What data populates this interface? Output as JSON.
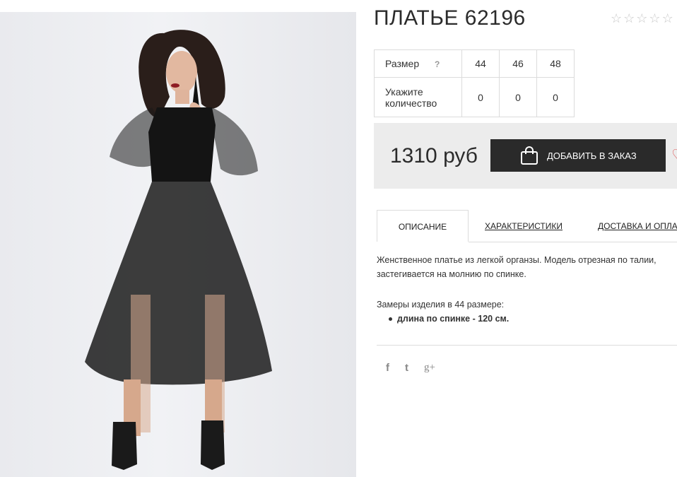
{
  "product": {
    "title": "ПЛАТЬЕ 62196",
    "rating_stars": [
      "☆",
      "☆",
      "☆",
      "☆",
      "☆"
    ]
  },
  "sizes": {
    "size_label": "Размер",
    "help_icon": "?",
    "values": [
      "44",
      "46",
      "48"
    ],
    "qty_label": "Укажите количество",
    "quantities": [
      "0",
      "0",
      "0"
    ]
  },
  "buy": {
    "price": "1310 руб",
    "add_button": "ДОБАВИТЬ В ЗАКАЗ",
    "heart_icon": "♡"
  },
  "tabs": {
    "description": "ОПИСАНИЕ",
    "characteristics": "ХАРАКТЕРИСТИКИ",
    "delivery": "ДОСТАВКА И ОПЛАТА"
  },
  "description": {
    "text": "Женственное платье из легкой органзы. Модель отрезная по талии, застегивается на молнию по спинке.",
    "measure_label": "Замеры изделия в 44 размере:",
    "bullet": "длина по спинке - 120 см."
  },
  "social": {
    "facebook": "f",
    "twitter": "t",
    "gplus": "g+"
  },
  "colors": {
    "button_bg": "#2a2a2a",
    "buybox_bg": "#ececec",
    "heart": "#e05a5a"
  }
}
